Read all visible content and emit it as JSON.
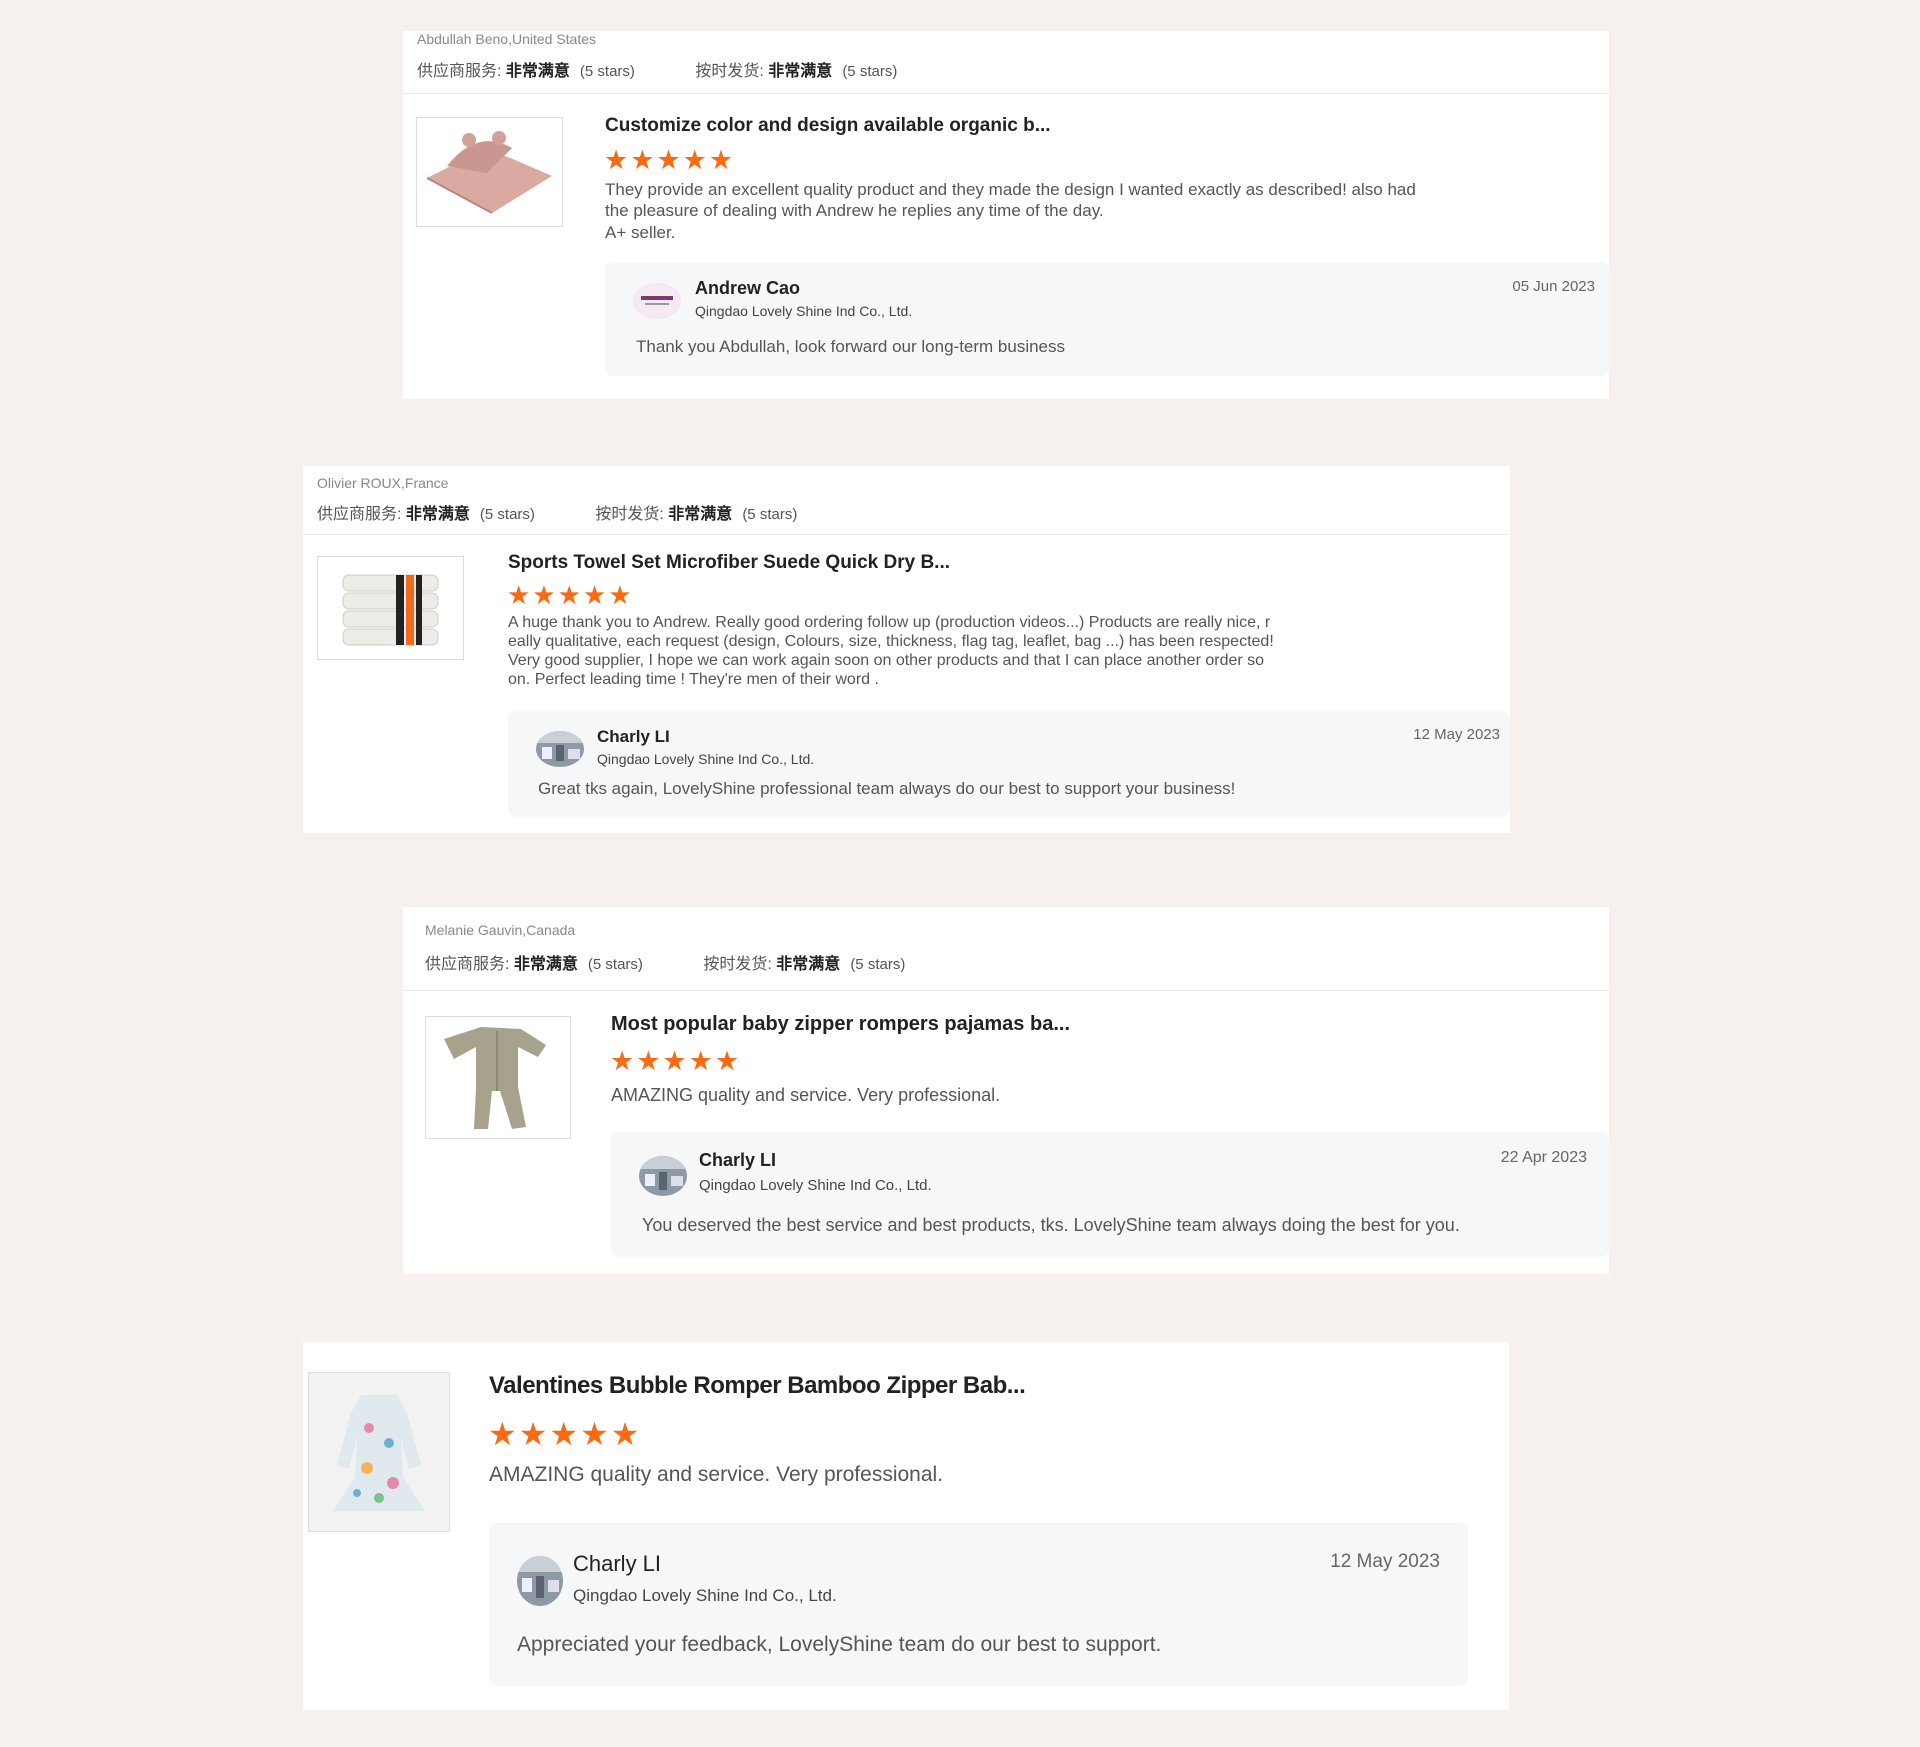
{
  "colors": {
    "page_bg": "#f6f1ec",
    "card_bg": "#ffffff",
    "star": "#f96a12",
    "reply_bg": "#f6f7f9"
  },
  "star_icon": "star-icon",
  "reviews": [
    {
      "buyer": "Abdullah Beno,United States",
      "ratings": [
        {
          "label": "供应商服务:",
          "value": "非常满意",
          "stars": "(5 stars)"
        },
        {
          "label": "按时发货:",
          "value": "非常满意",
          "stars": "(5 stars)"
        }
      ],
      "product_title": "Customize color and design available organic b...",
      "rating": 5,
      "star_glyphs": "★★★★★",
      "text_lines": [
        "They provide an excellent quality product and they made the design I wanted exactly as described! also had",
        "the pleasure of dealing with Andrew he replies any time of the day.",
        "A+ seller."
      ],
      "thumb_icon": "hooded-towel-icon",
      "reply": {
        "name": "Andrew Cao",
        "company": "Qingdao Lovely Shine Ind Co., Ltd.",
        "date": "05 Jun 2023",
        "message": "Thank you Abdullah, look forward our long-term business",
        "avatar_icon": "lovely-shine-logo-avatar"
      }
    },
    {
      "buyer": "Olivier ROUX,France",
      "ratings": [
        {
          "label": "供应商服务:",
          "value": "非常满意",
          "stars": "(5 stars)"
        },
        {
          "label": "按时发货:",
          "value": "非常满意",
          "stars": "(5 stars)"
        }
      ],
      "product_title": "Sports Towel Set Microfiber Suede Quick Dry B...",
      "rating": 5,
      "star_glyphs": "★★★★★",
      "text_lines": [
        "A huge thank you to Andrew. Really good ordering follow up (production videos...) Products are really nice, r",
        "eally qualitative, each request (design, Colours, size, thickness, flag tag, leaflet, bag ...) has been respected!",
        "Very good supplier, I hope we can work again soon on other products and that I can place another order so",
        "on. Perfect leading time ! They're men of their word ."
      ],
      "thumb_icon": "towel-stack-icon",
      "reply": {
        "name": "Charly LI",
        "company": "Qingdao Lovely Shine Ind Co., Ltd.",
        "date": "12 May 2023",
        "message": "Great tks again, LovelyShine professional team always do our best to support your business!",
        "avatar_icon": "factory-photo-avatar"
      }
    },
    {
      "buyer": "Melanie Gauvin,Canada",
      "ratings": [
        {
          "label": "供应商服务:",
          "value": "非常满意",
          "stars": "(5 stars)"
        },
        {
          "label": "按时发货:",
          "value": "非常满意",
          "stars": "(5 stars)"
        }
      ],
      "product_title": "Most popular baby zipper rompers pajamas ba...",
      "rating": 5,
      "star_glyphs": "★★★★★",
      "text_lines": [
        "AMAZING quality and service. Very professional."
      ],
      "thumb_icon": "baby-romper-icon",
      "reply": {
        "name": "Charly LI",
        "company": "Qingdao Lovely Shine Ind Co., Ltd.",
        "date": "22 Apr 2023",
        "message": "You deserved the best service and best products, tks. LovelyShine team always doing the best for you.",
        "avatar_icon": "factory-photo-avatar"
      }
    },
    {
      "product_title": "Valentines Bubble Romper Bamboo Zipper Bab...",
      "rating": 5,
      "star_glyphs": "★★★★★",
      "text_lines": [
        "AMAZING quality and service. Very professional."
      ],
      "thumb_icon": "floral-dress-icon",
      "reply": {
        "name": "Charly LI",
        "company": "Qingdao Lovely Shine Ind Co., Ltd.",
        "date": "12 May 2023",
        "message": "Appreciated your feedback, LovelyShine team do our best to support.",
        "avatar_icon": "factory-photo-avatar"
      }
    }
  ]
}
